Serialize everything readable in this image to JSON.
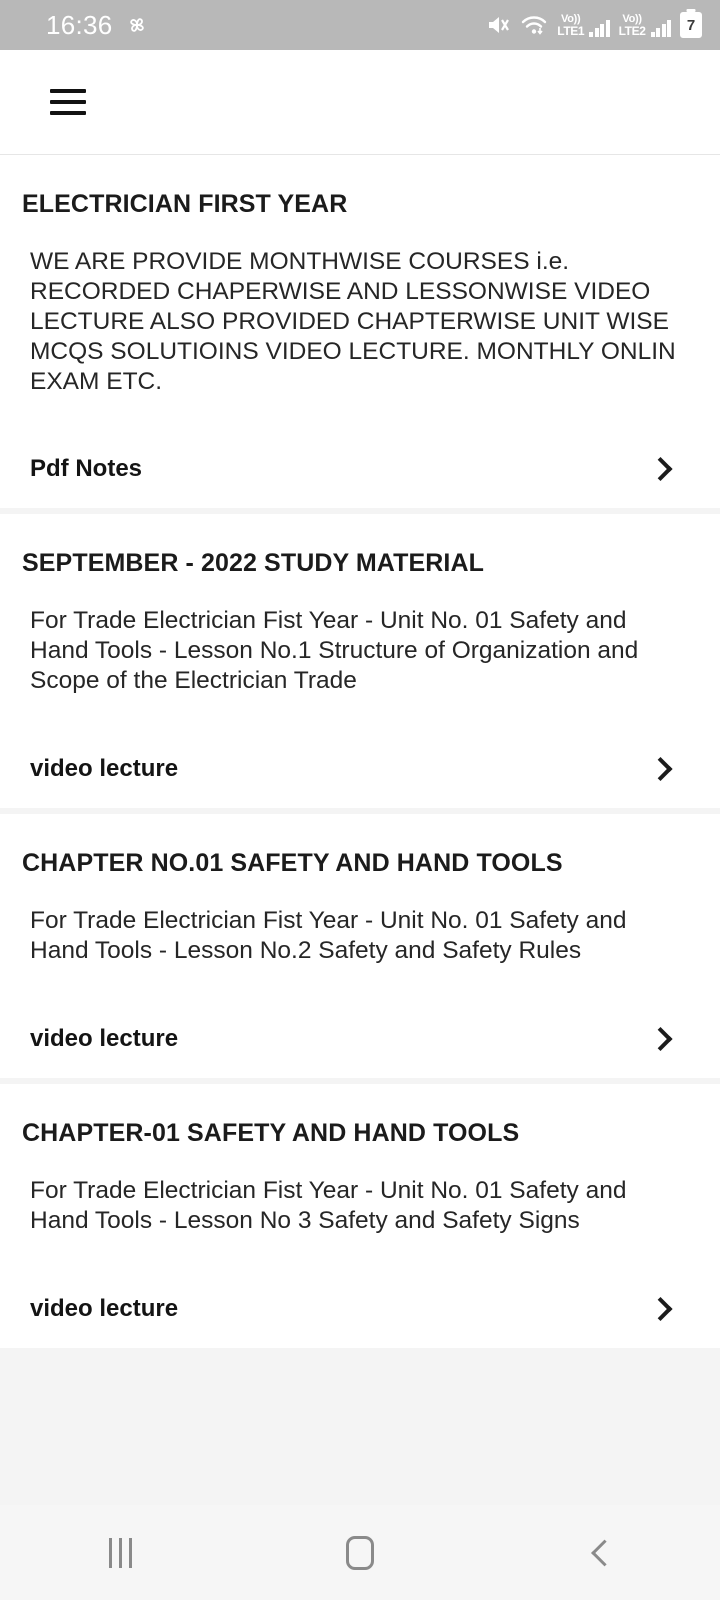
{
  "status_bar": {
    "time": "16:36",
    "app_badge_icon": "pinwheel-icon",
    "icons": [
      "mute-icon",
      "wifi-icon",
      "volte1-signal-icon",
      "volte2-signal-icon",
      "battery-icon"
    ],
    "sim1_label_top": "Vo))",
    "sim1_label_bottom": "LTE1",
    "sim2_label_top": "Vo))",
    "sim2_label_bottom": "LTE2",
    "battery_level": "7",
    "background_color": "#b8b8b8"
  },
  "app_bar": {
    "menu_icon": "hamburger-menu-icon",
    "background_color": "#ffffff"
  },
  "cards": [
    {
      "title": "ELECTRICIAN FIRST YEAR",
      "description": "WE ARE PROVIDE MONTHWISE COURSES i.e. RECORDED CHAPERWISE AND LESSONWISE VIDEO  LECTURE ALSO PROVIDED CHAPTERWISE UNIT WISE MCQS SOLUTIOINS VIDEO LECTURE. MONTHLY ONLIN EXAM ETC.",
      "action_label": "Pdf Notes",
      "action_icon": "chevron-right-icon"
    },
    {
      "title": "SEPTEMBER - 2022 STUDY MATERIAL",
      "description": "For Trade Electrician Fist Year - Unit No. 01 Safety and Hand Tools - Lesson No.1 Structure of Organization and Scope of the Electrician Trade",
      "action_label": "video lecture",
      "action_icon": "chevron-right-icon"
    },
    {
      "title": "CHAPTER NO.01 SAFETY AND HAND TOOLS",
      "description": "For Trade Electrician Fist Year - Unit No. 01 Safety and Hand Tools - Lesson No.2 Safety and Safety Rules",
      "action_label": "video lecture",
      "action_icon": "chevron-right-icon"
    },
    {
      "title": "CHAPTER-01 SAFETY AND HAND TOOLS",
      "description": "For Trade Electrician Fist Year - Unit No. 01 Safety and Hand Tools - Lesson No 3 Safety and Safety Signs",
      "action_label": "video lecture",
      "action_icon": "chevron-right-icon"
    }
  ],
  "nav_bar": {
    "recents_icon": "recents-icon",
    "home_icon": "home-icon",
    "back_icon": "back-icon",
    "background_color": "#f6f6f6"
  }
}
